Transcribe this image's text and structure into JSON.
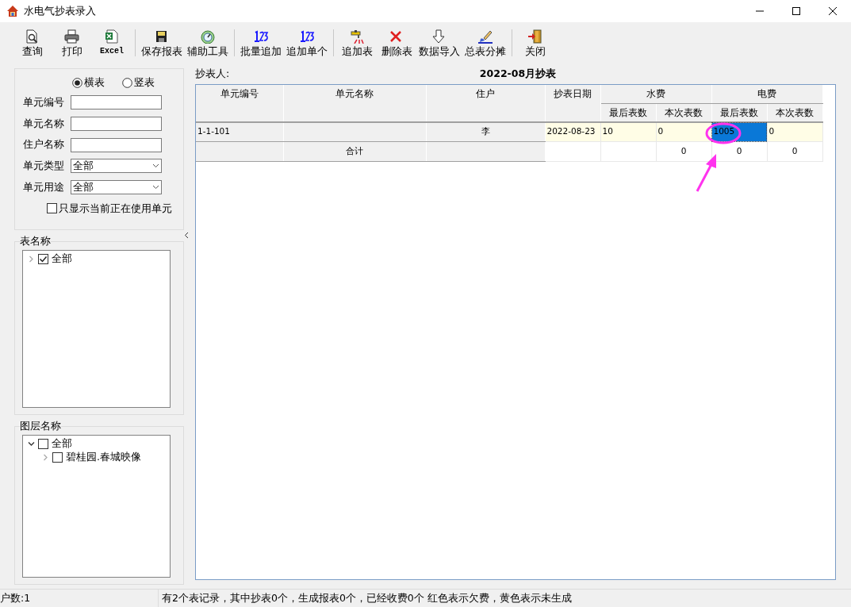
{
  "window": {
    "title": "水电气抄表录入"
  },
  "toolbar_groups": [
    [
      {
        "label": "查询",
        "kind": "search"
      },
      {
        "label": "打印",
        "kind": "print"
      },
      {
        "label": "Excel",
        "kind": "excel"
      }
    ],
    [
      {
        "label": "保存报表",
        "kind": "save"
      },
      {
        "label": "辅助工具",
        "kind": "tools"
      }
    ],
    [
      {
        "label": "批量追加",
        "kind": "numbers"
      },
      {
        "label": "追加单个",
        "kind": "numbers"
      }
    ],
    [
      {
        "label": "追加表",
        "kind": "tap"
      },
      {
        "label": "删除表",
        "kind": "delete"
      },
      {
        "label": "数据导入",
        "kind": "import"
      },
      {
        "label": "总表分摊",
        "kind": "brush"
      }
    ],
    [
      {
        "label": "关闭",
        "kind": "exit"
      }
    ]
  ],
  "filter": {
    "radios": [
      {
        "label": "横表",
        "selected": true
      },
      {
        "label": "竖表",
        "selected": false
      }
    ],
    "fields": [
      {
        "label": "单元编号",
        "kind": "text"
      },
      {
        "label": "单元名称",
        "kind": "text"
      },
      {
        "label": "住户名称",
        "kind": "text"
      },
      {
        "label": "单元类型",
        "kind": "select",
        "value": "全部"
      },
      {
        "label": "单元用途",
        "kind": "select",
        "value": "全部"
      }
    ],
    "checkbox": {
      "label": "只显示当前正在使用单元",
      "checked": false
    }
  },
  "table_tree": {
    "title": "表名称",
    "items": [
      {
        "label": "全部",
        "checked": true,
        "expanded": false
      }
    ]
  },
  "layer_tree": {
    "title": "图层名称",
    "items": [
      {
        "label": "全部",
        "checked": false,
        "expanded": true,
        "children": [
          {
            "label": "碧桂园.春城映像",
            "checked": false,
            "expanded": false
          }
        ]
      }
    ]
  },
  "grid": {
    "reader_label": "抄表人:",
    "title": "2022-08月抄表",
    "columns": [
      {
        "label": "单元编号"
      },
      {
        "label": "单元名称"
      },
      {
        "label": "住户"
      },
      {
        "label": "抄表日期"
      },
      {
        "label": "水费",
        "colspan": 2,
        "children": [
          {
            "label": "最后表数"
          },
          {
            "label": "本次表数"
          }
        ]
      },
      {
        "label": "电费",
        "colspan": 2,
        "children": [
          {
            "label": "最后表数"
          },
          {
            "label": "本次表数"
          }
        ]
      }
    ],
    "rows": [
      {
        "kind": "data",
        "cells": [
          {
            "text": "1-1-101",
            "selected": false
          },
          {
            "text": null,
            "selected": false
          },
          {
            "text": "李",
            "selected": false
          },
          {
            "text": "2022-08-23",
            "selected": false
          },
          {
            "text": "10",
            "selected": false
          },
          {
            "text": "0",
            "selected": false
          },
          {
            "text": "1005",
            "selected": true
          },
          {
            "text": "0",
            "selected": false
          }
        ]
      },
      {
        "kind": "total",
        "cells": [
          null,
          "合计",
          null,
          null,
          null,
          "0",
          "0",
          "0"
        ]
      }
    ]
  },
  "status_bar": {
    "count": "户数:1",
    "message": "有2个表记录，其中抄表0个，生成报表0个，已经收费0个 红色表示欠费，黄色表示未生成"
  }
}
